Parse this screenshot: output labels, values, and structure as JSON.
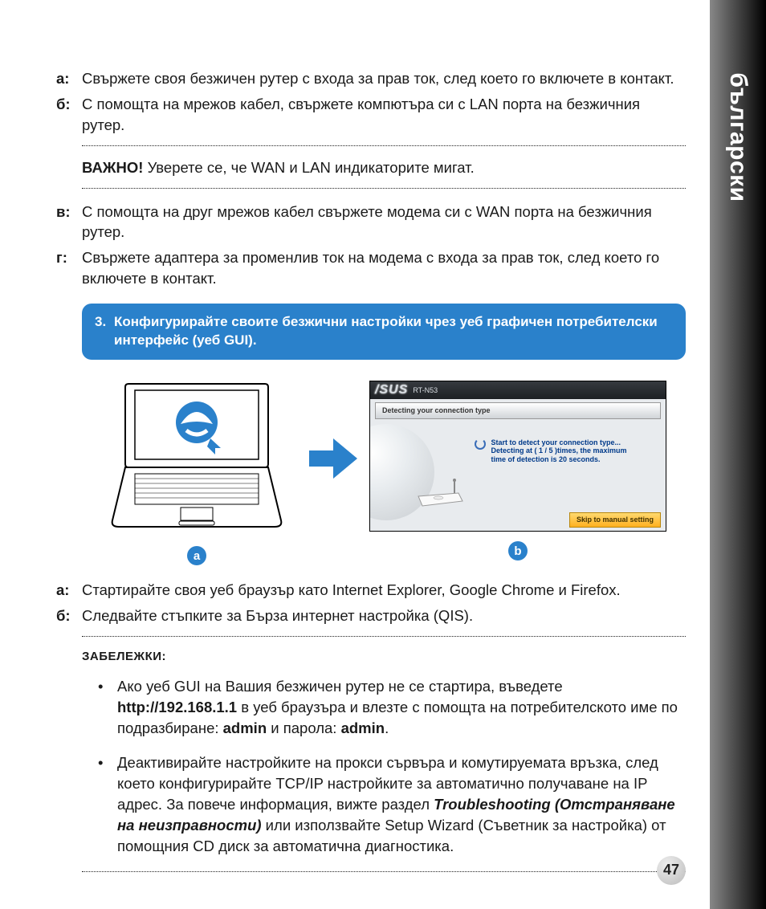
{
  "side_label": "български",
  "steps_top": {
    "a": {
      "letter": "а:",
      "text": "Свържете своя безжичен рутер с входа за прав ток, след което го включете в контакт."
    },
    "b": {
      "letter": "б:",
      "text": "С помощта на мрежов кабел, свържете компютъра си с LAN порта на безжичния рутер."
    }
  },
  "important": {
    "label": "ВАЖНО!",
    "text": "  Уверете се, че WAN и LAN индикаторите мигат."
  },
  "steps_mid": {
    "c": {
      "letter": "в:",
      "text": "С помощта на друг мрежов кабел свържете модема си с WAN порта на безжичния рутер."
    },
    "d": {
      "letter": "г:",
      "text": "Свържете адаптера за променлив ток на модема с входа за прав ток, след което го включете в контакт."
    }
  },
  "blue_step": {
    "num": "3.",
    "text": "Конфигурирайте своите безжични настройки чрез уеб графичен потребителски интерфейс (уеб GUI)."
  },
  "illus": {
    "badge_a": "a",
    "badge_b": "b"
  },
  "router_ui": {
    "brand": "/SUS",
    "model": "RT-N53",
    "bar": "Detecting your connection type",
    "msg1": "Start to detect your connection type...",
    "msg2": "Detecting at ( 1 / 5 )times, the maximum time of detection is 20 seconds.",
    "skip": "Skip to manual setting"
  },
  "steps_bottom": {
    "a": {
      "letter": "а:",
      "text": "Стартирайте своя уеб браузър като Internet Explorer, Google Chrome и Firefox."
    },
    "b": {
      "letter": "б:",
      "text": "Следвайте стъпките за Бърза интернет настройка (QIS)."
    }
  },
  "notes": {
    "title": "ЗАБЕЛЕЖКИ:",
    "n1_a": "Ако уеб GUI на Вашия безжичен рутер не се стартира, въведете ",
    "n1_b": "http://192.168.1.1",
    "n1_c": " в уеб браузъра и влезте с помощта на потребителското име по подразбиране: ",
    "n1_d": "admin",
    "n1_e": " и парола: ",
    "n1_f": "admin",
    "n1_g": ".",
    "n2_a": "Деактивирайте настройките на прокси сървъра и комутируемата връзка, след което конфигурирайте TCP/IP настройките за автоматично получаване на IP адрес. За повече информация, вижте раздел ",
    "n2_b": "Troubleshooting (Отстраняване на неизправности)",
    "n2_c": " или използвайте Setup Wizard (Съветник за настройка) от помощния CD диск за автоматична диагностика."
  },
  "page_num": "47"
}
